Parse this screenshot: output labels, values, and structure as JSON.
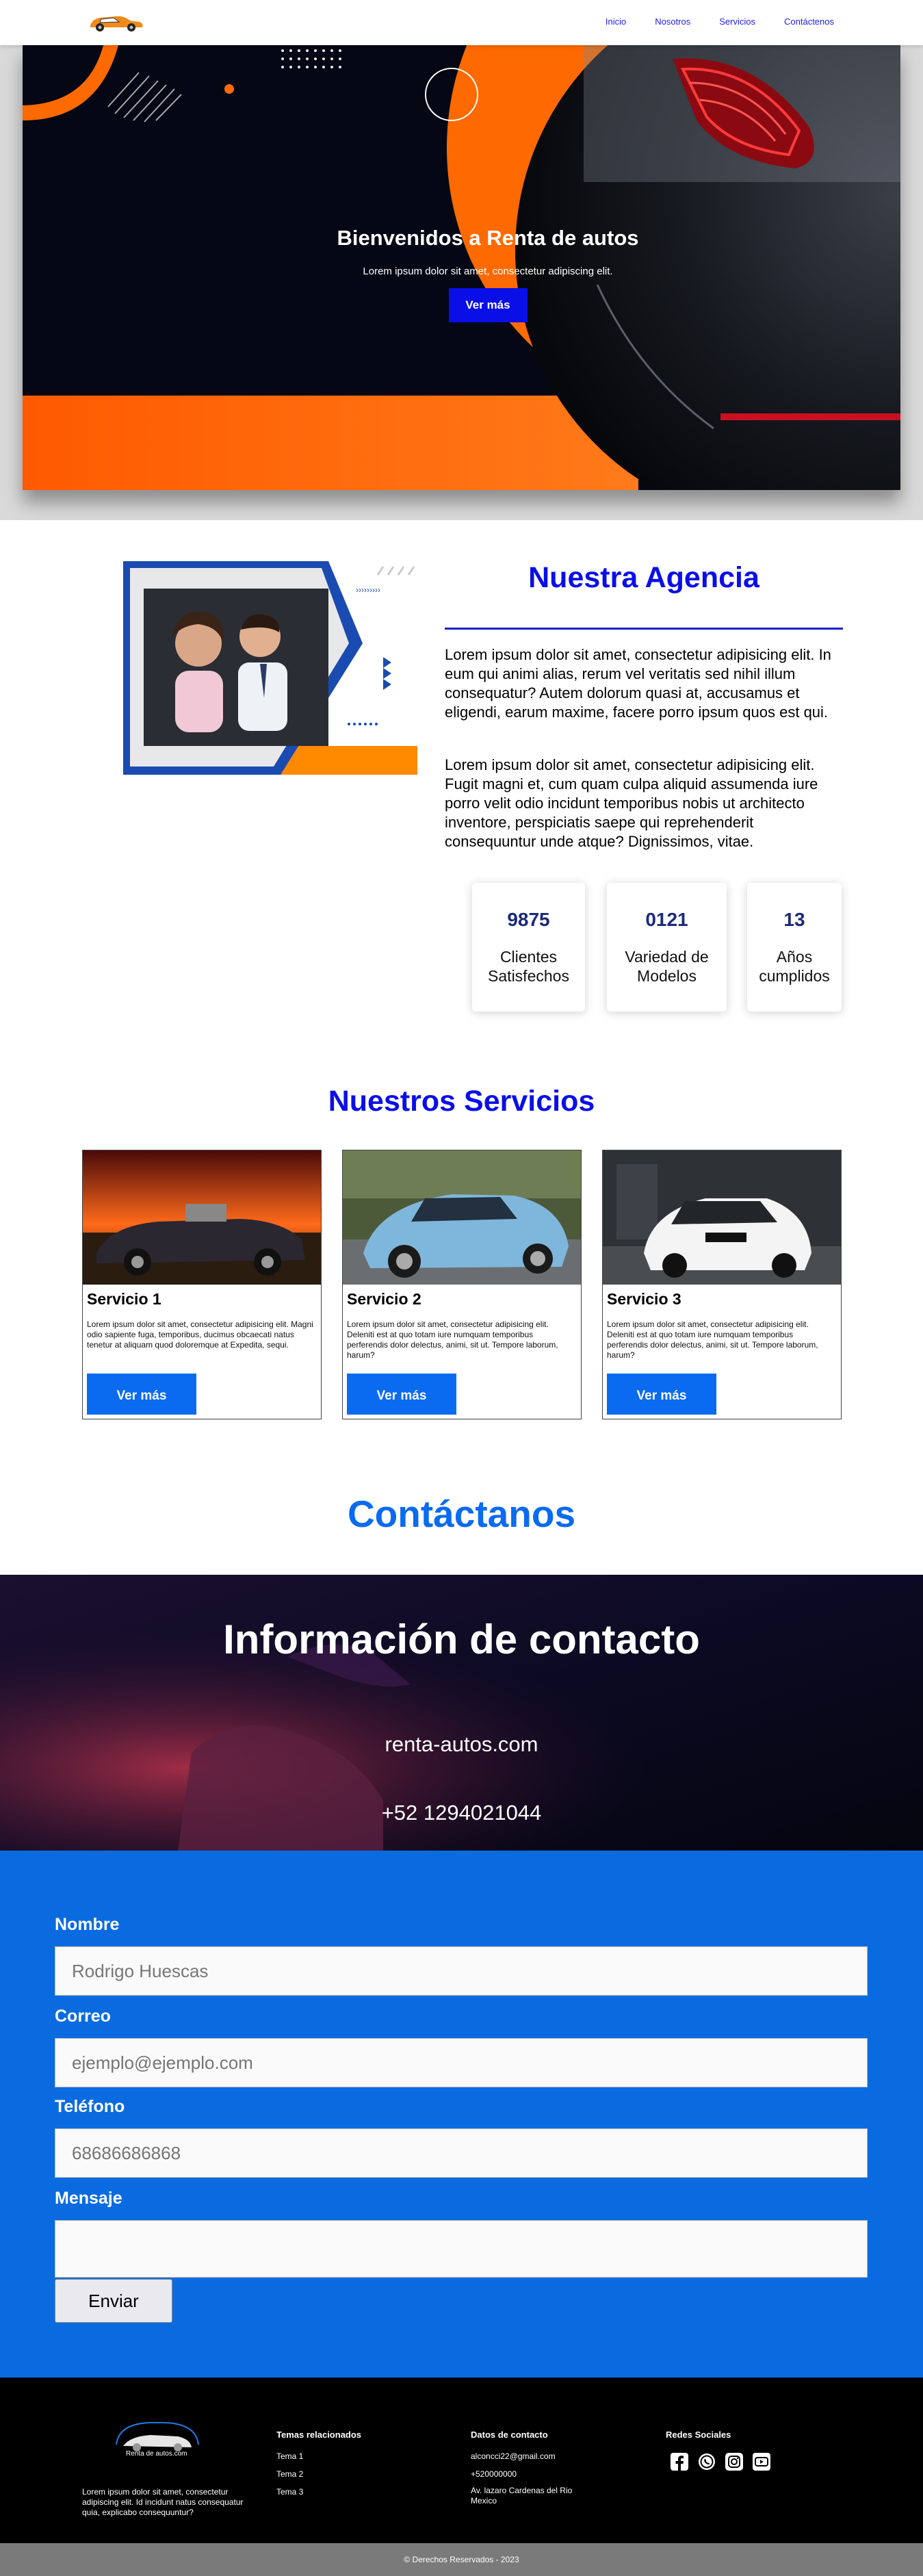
{
  "nav": {
    "links": [
      "Inicio",
      "Nosotros",
      "Servicios",
      "Contáctenos"
    ]
  },
  "hero": {
    "title": "Bienvenidos a Renta de autos",
    "subtitle": "Lorem ipsum dolor sit amet, consectetur adipiscing elit.",
    "button": "Ver más"
  },
  "agency": {
    "title": "Nuestra Agencia",
    "p1": "Lorem ipsum dolor sit amet, consectetur adipisicing elit. In eum qui animi alias, rerum vel veritatis sed nihil illum consequatur? Autem dolorum quasi at, accusamus et eligendi, earum maxime, facere porro ipsum quos est qui.",
    "p2": "Lorem ipsum dolor sit amet, consectetur adipisicing elit. Fugit magni et, cum quam culpa aliquid assumenda iure porro velit odio incidunt temporibus nobis ut architecto inventore, perspiciatis saepe qui reprehenderit consequuntur unde atque? Dignissimos, vitae.",
    "stats": [
      {
        "num": "9875",
        "label": "Clientes Satisfechos"
      },
      {
        "num": "0121",
        "label": "Variedad de Modelos"
      },
      {
        "num": "13",
        "label": "Años cumplidos"
      }
    ]
  },
  "services": {
    "title": "Nuestros Servicios",
    "cards": [
      {
        "title": "Servicio 1",
        "desc": "Lorem ipsum dolor sit amet, consectetur adipisicing elit. Magni odio sapiente fuga, temporibus, ducimus obcaecati natus tenetur at aliquam quod doloremque at Expedita, sequi.",
        "button": "Ver más"
      },
      {
        "title": "Servicio 2",
        "desc": "Lorem ipsum dolor sit amet, consectetur adipisicing elit. Deleniti est at quo totam iure numquam temporibus perferendis dolor delectus, animi, sit ut. Tempore laborum, harum?",
        "button": "Ver más"
      },
      {
        "title": "Servicio 3",
        "desc": "Lorem ipsum dolor sit amet, consectetur adipisicing elit. Deleniti est at quo totam iure numquam temporibus perferendis dolor delectus, animi, sit ut. Tempore laborum, harum?",
        "button": "Ver más"
      }
    ]
  },
  "contact": {
    "title": "Contáctanos",
    "band_title": "Información de contacto",
    "site": "renta-autos.com",
    "phone": "+52 1294021044",
    "form": {
      "name_label": "Nombre",
      "name_value": "Rodrigo Huescas",
      "email_label": "Correo",
      "email_placeholder": "ejemplo@ejemplo.com",
      "phone_label": "Teléfono",
      "phone_placeholder": "68686686868",
      "message_label": "Mensaje",
      "message_value": "",
      "send": "Enviar"
    }
  },
  "footer": {
    "logo_text": "Renta de autos.com",
    "about": "Lorem ipsum dolor sit amet, consectetur adipiscing elit. Id incidunt natus consequatur quia, explicabo consequuntur?",
    "topics_title": "Temas relacionados",
    "topics": [
      "Tema 1",
      "Tema 2",
      "Tema 3"
    ],
    "contact_title": "Datos de contacto",
    "contact_lines": [
      "alconcci22@gmail.com",
      "+520000000",
      "Av. lazaro Cardenas del Rio Mexico"
    ],
    "social_title": "Redes Sociales",
    "social_icons": [
      "facebook-icon",
      "whatsapp-icon",
      "instagram-icon",
      "youtube-icon"
    ],
    "copyright": "© Derechos Reservados - 2023"
  },
  "colors": {
    "primary_blue": "#0a0fe8",
    "contact_blue": "#0a6be0",
    "orange": "#ff6a00"
  }
}
